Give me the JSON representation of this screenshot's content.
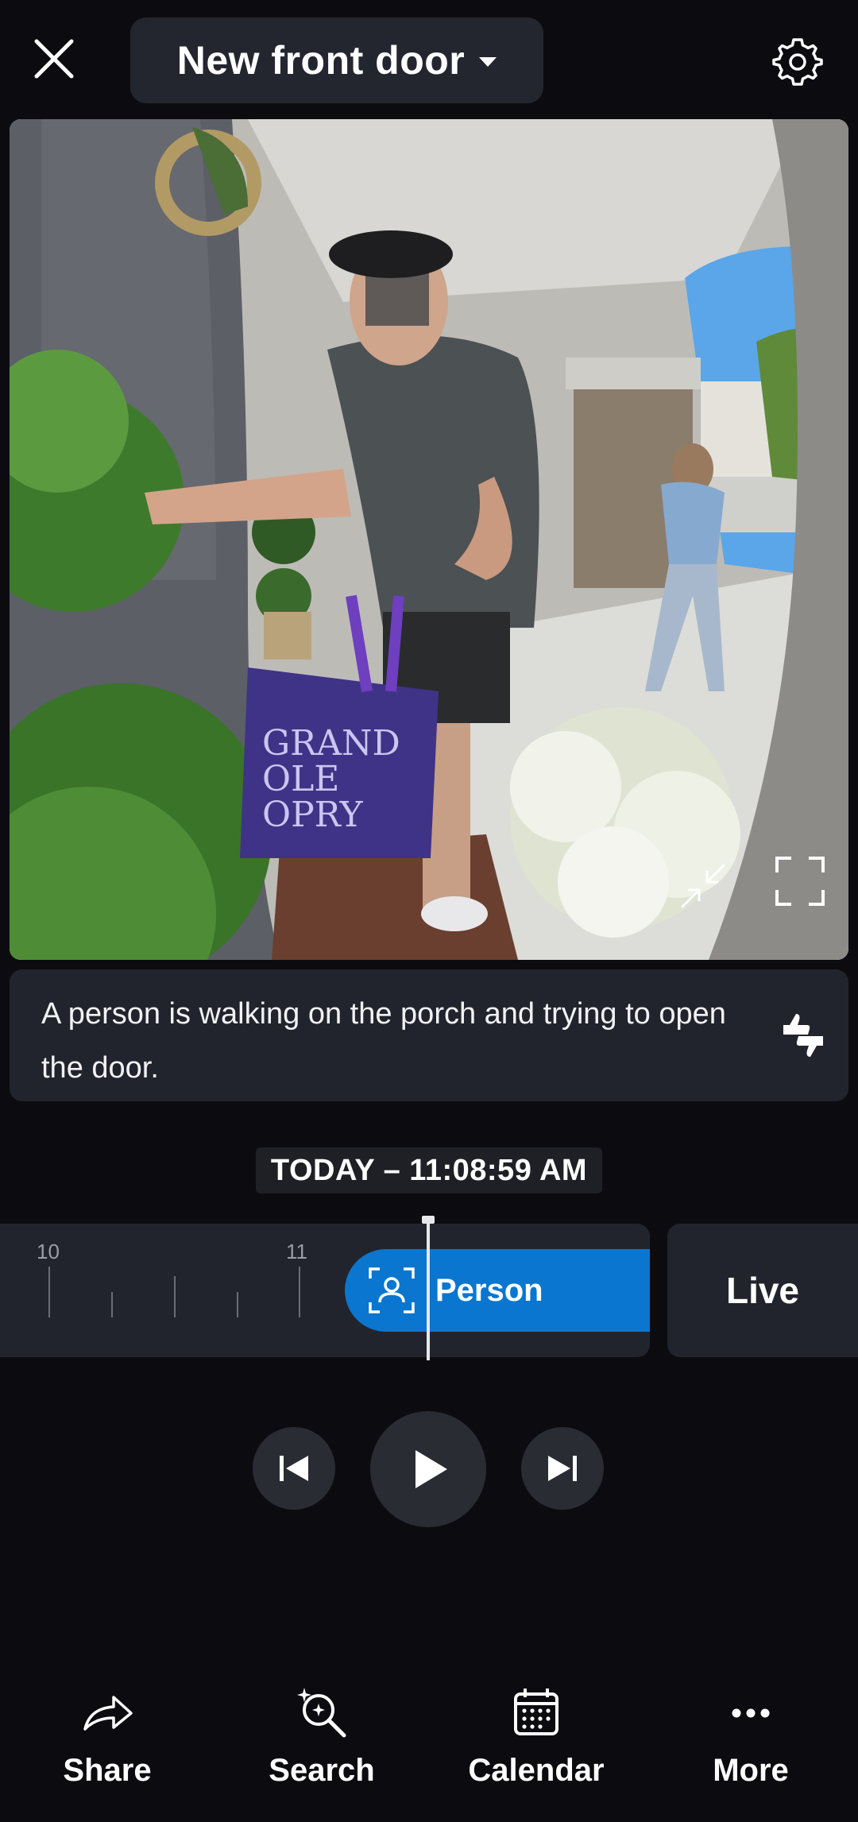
{
  "header": {
    "camera_title": "New front door",
    "close_icon": "close-icon",
    "settings_icon": "gear-icon"
  },
  "video": {
    "bag_text": [
      "GRAND",
      "OLE",
      "OPRY"
    ],
    "controls": [
      "collapse-icon",
      "fullscreen-icon"
    ]
  },
  "description": {
    "text": "A person is walking on the porch and trying to open the door.",
    "feedback_icon": "thumbs-feedback-icon"
  },
  "timestamp": "TODAY – 11:08:59 AM",
  "timeline": {
    "labels": [
      "10",
      "11"
    ],
    "event_label": "Person",
    "event_icon": "person-icon",
    "live_label": "Live"
  },
  "playback": [
    "skip-previous-icon",
    "play-icon",
    "skip-next-icon"
  ],
  "bottom_nav": {
    "share": "Share",
    "search": "Search",
    "calendar": "Calendar",
    "more": "More"
  },
  "colors": {
    "background": "#0c0c10",
    "panel": "#22242d",
    "accent": "#0a76cf"
  }
}
